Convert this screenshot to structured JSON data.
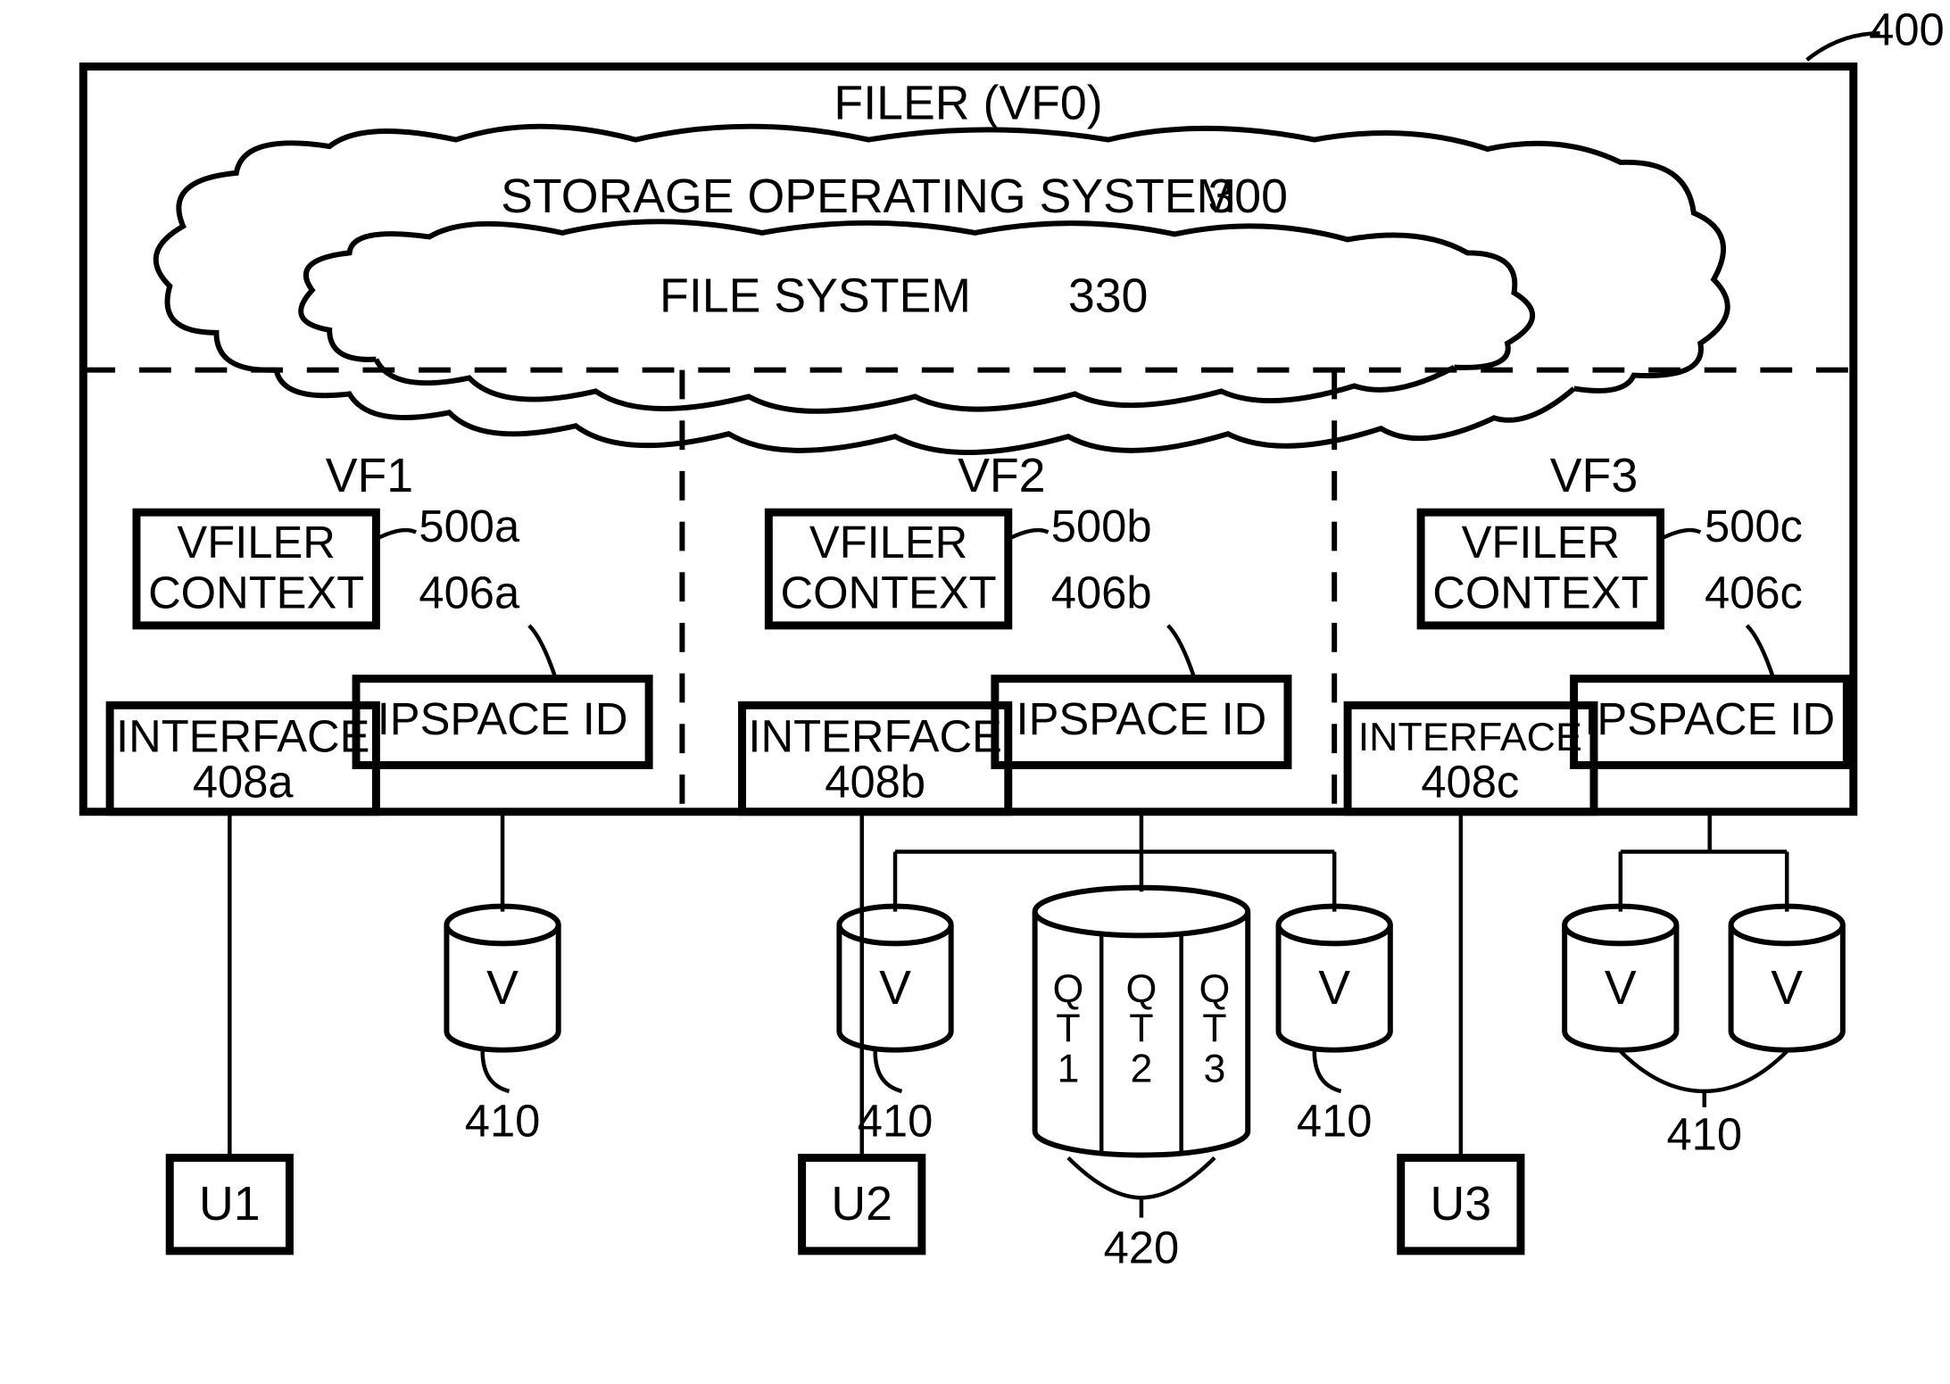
{
  "figureRef": "400",
  "title": "FILER (VF0)",
  "outerCloud": {
    "label": "STORAGE OPERATING SYSTEM",
    "ref": "300"
  },
  "innerCloud": {
    "label": "FILE SYSTEM",
    "ref": "330"
  },
  "vfilers": [
    {
      "name": "VF1",
      "context": {
        "label1": "VFILER",
        "label2": "CONTEXT",
        "ref": "500a"
      },
      "ipspace": {
        "label": "IPSPACE ID",
        "ref": "406a"
      },
      "interface": {
        "label1": "INTERFACE",
        "label2": "408a"
      },
      "user": "U1",
      "volumeRef": "410"
    },
    {
      "name": "VF2",
      "context": {
        "label1": "VFILER",
        "label2": "CONTEXT",
        "ref": "500b"
      },
      "ipspace": {
        "label": "IPSPACE ID",
        "ref": "406b"
      },
      "interface": {
        "label1": "INTERFACE",
        "label2": "408b"
      },
      "user": "U2",
      "volumeRef": "410",
      "qt": {
        "slices": [
          "QT1",
          "QT2",
          "QT3"
        ],
        "ref": "420"
      }
    },
    {
      "name": "VF3",
      "context": {
        "label1": "VFILER",
        "label2": "CONTEXT",
        "ref": "500c"
      },
      "ipspace": {
        "label": "IPSPACE ID",
        "ref": "406c"
      },
      "interface": {
        "label1": "INTERFACE",
        "label2": "408c"
      },
      "user": "U3",
      "volumeRef": "410"
    }
  ],
  "volumeLabel": "V"
}
